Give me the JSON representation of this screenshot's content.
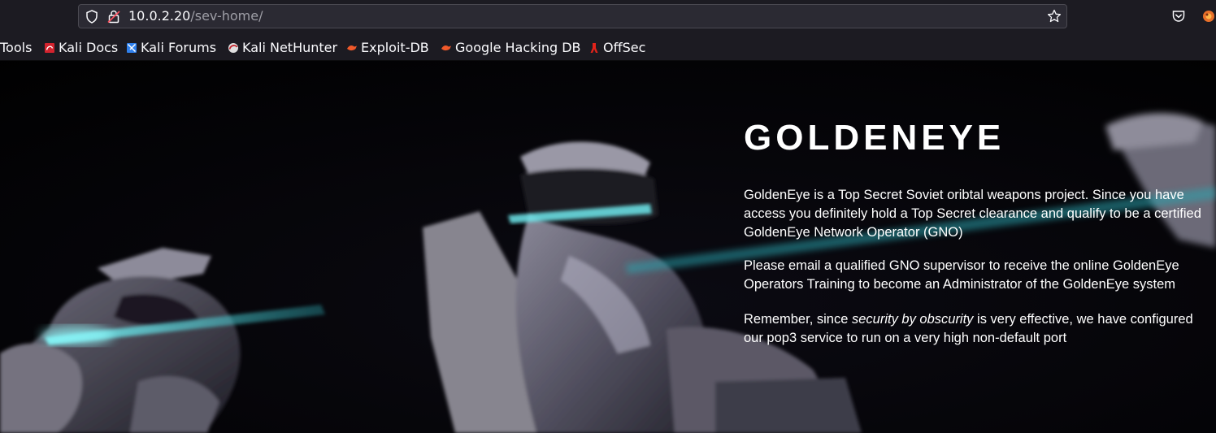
{
  "browser": {
    "url_host": "10.0.2.20",
    "url_path": "/sev-home/",
    "bookmarks": [
      {
        "label": "Tools",
        "icon": "none"
      },
      {
        "label": "Kali Docs",
        "icon": "kali-docs-icon"
      },
      {
        "label": "Kali Forums",
        "icon": "kali-forums-icon"
      },
      {
        "label": "Kali NetHunter",
        "icon": "kali-nethunter-icon"
      },
      {
        "label": "Exploit-DB",
        "icon": "exploit-db-icon"
      },
      {
        "label": "Google Hacking DB",
        "icon": "google-hacking-db-icon"
      },
      {
        "label": "OffSec",
        "icon": "offsec-icon"
      }
    ]
  },
  "page": {
    "title": "GOLDENEYE",
    "paragraph1": "GoldenEye is a Top Secret Soviet oribtal weapons project. Since you have access you definitely hold a Top Secret clearance and qualify to be a certified GoldenEye Network Operator (GNO)",
    "paragraph2": "Please email a qualified GNO supervisor to receive the online GoldenEye Operators Training to become an Administrator of the GoldenEye system",
    "paragraph3_before": "Remember, since ",
    "paragraph3_emphasis": "security by obscurity",
    "paragraph3_after": " is very effective, we have configured our pop3 service to run on a very high non-default port"
  },
  "colors": {
    "chrome_bg": "#1c1b22",
    "urlbar_bg": "#2b2a33",
    "page_bg": "#030306",
    "laser": "#4fe3e6",
    "text": "#ffffff"
  }
}
